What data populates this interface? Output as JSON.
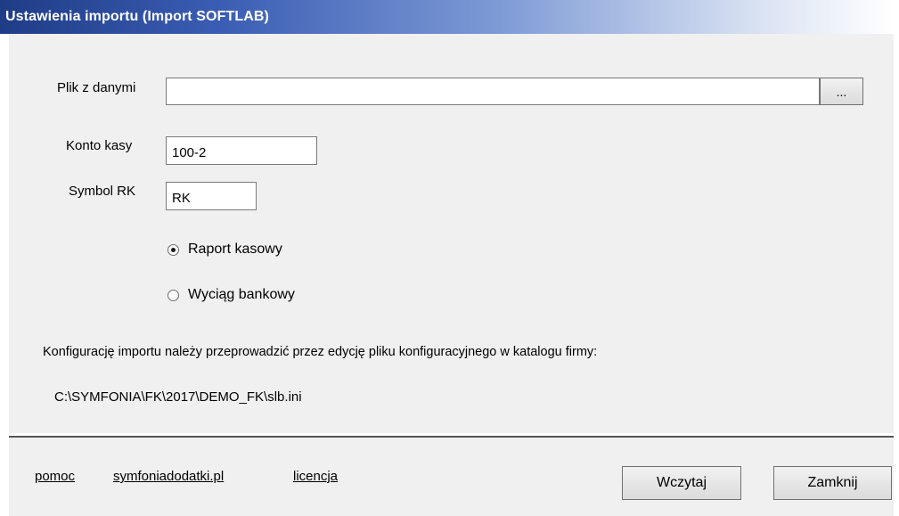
{
  "window": {
    "title": "Ustawienia importu (Import SOFTLAB)"
  },
  "form": {
    "file_label": "Plik z danymi",
    "file_value": "",
    "browse_label": "...",
    "account_label": "Konto kasy",
    "account_value": "100-2",
    "symbol_label": "Symbol RK",
    "symbol_value": "RK",
    "radio_options": [
      {
        "label": "Raport kasowy",
        "checked": true
      },
      {
        "label": "Wyciąg bankowy",
        "checked": false
      }
    ],
    "info_text": "Konfigurację importu należy przeprowadzić przez edycję pliku konfiguracyjnego w katalogu firmy:",
    "config_path": "C:\\SYMFONIA\\FK\\2017\\DEMO_FK\\slb.ini"
  },
  "footer": {
    "links": [
      "pomoc",
      "symfoniadodatki.pl",
      "licencja"
    ],
    "load_button": "Wczytaj",
    "close_button": "Zamknij"
  }
}
